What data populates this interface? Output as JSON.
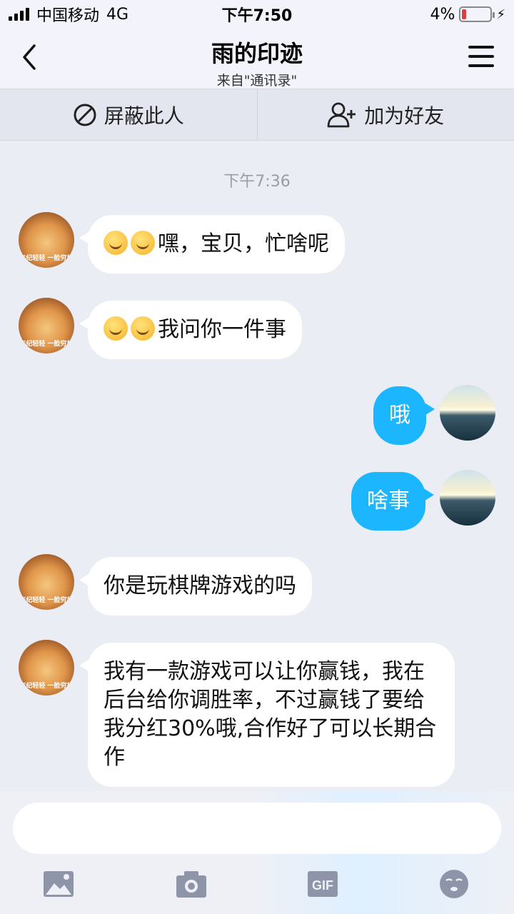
{
  "status_bar": {
    "carrier": "中国移动",
    "network": "4G",
    "time": "下午7:50",
    "battery_percent": "4%",
    "battery_level": 0.04,
    "battery_color": "#e23b3b"
  },
  "header": {
    "title": "雨的印迹",
    "subtitle": "来自\"通讯录\""
  },
  "actions": {
    "block_label": "屏蔽此人",
    "add_friend_label": "加为好友"
  },
  "chat": {
    "timestamp": "下午7:36",
    "avatar_caption": "年纪轻轻 一脸穷相",
    "messages": [
      {
        "side": "left",
        "emojis": [
          "grin",
          "smirk"
        ],
        "text": "嘿，宝贝，忙啥呢"
      },
      {
        "side": "left",
        "emojis": [
          "smirk",
          "smirk"
        ],
        "text": "我问你一件事"
      },
      {
        "side": "right",
        "text": "哦"
      },
      {
        "side": "right",
        "text": "啥事"
      },
      {
        "side": "left",
        "text": "你是玩棋牌游戏的吗"
      },
      {
        "side": "left",
        "text": "我有一款游戏可以让你赢钱，我在后台给你调胜率，不过赢钱了要给我分红30%哦,合作好了可以长期合作"
      }
    ]
  },
  "input": {
    "placeholder": "",
    "tools": [
      "image-icon",
      "camera-icon",
      "gif-icon",
      "emoji-icon"
    ],
    "gif_label": "GIF"
  },
  "colors": {
    "accent": "#1cb6ff",
    "background": "#ebedf5"
  }
}
